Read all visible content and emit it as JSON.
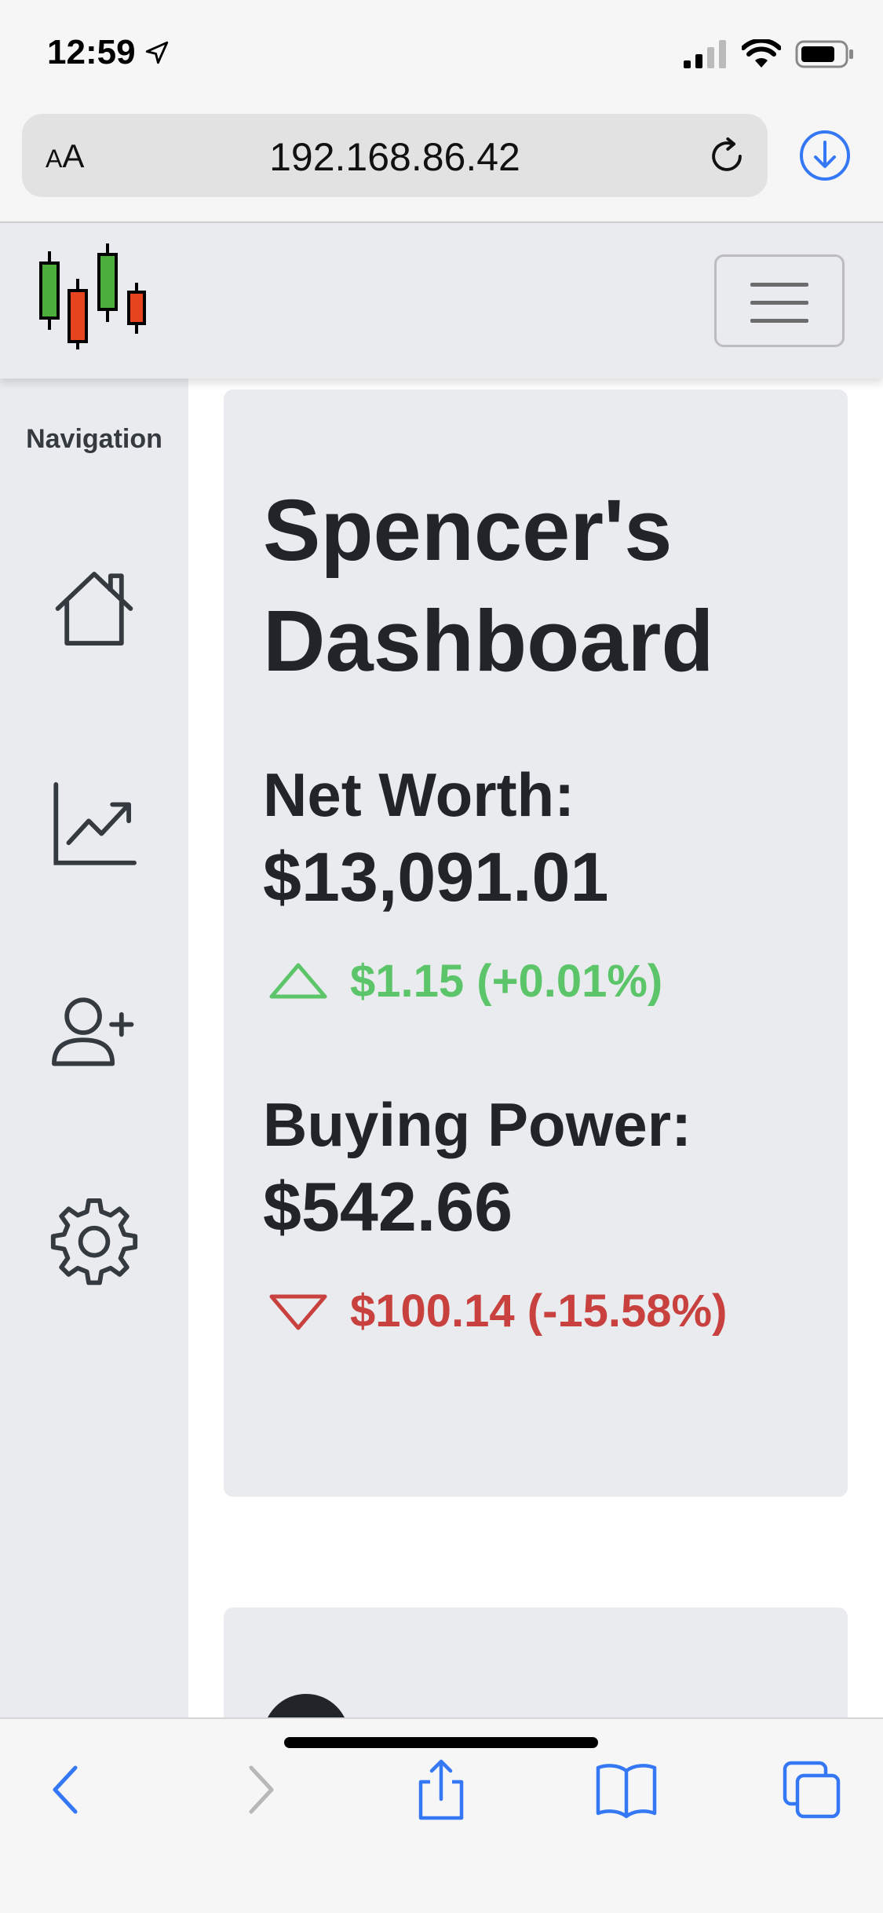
{
  "status_bar": {
    "time": "12:59"
  },
  "browser": {
    "text_size_label_small": "A",
    "text_size_label_large": "A",
    "url": "192.168.86.42"
  },
  "sidebar": {
    "title": "Navigation",
    "items": [
      {
        "icon": "home-icon"
      },
      {
        "icon": "chart-icon"
      },
      {
        "icon": "add-user-icon"
      },
      {
        "icon": "gear-icon"
      }
    ]
  },
  "dashboard": {
    "title_line1": "Spencer's",
    "title_line2": "Dashboard",
    "net_worth": {
      "label": "Net Worth:",
      "value": "$13,091.01",
      "change": "$1.15 (+0.01%)",
      "direction": "up"
    },
    "buying_power": {
      "label": "Buying Power:",
      "value": "$542.66",
      "change": "$100.14 (-15.58%)",
      "direction": "down"
    }
  },
  "colors": {
    "positive": "#5cc56a",
    "negative": "#c9413f",
    "panel": "#e9ebee",
    "accent": "#3478f6"
  }
}
